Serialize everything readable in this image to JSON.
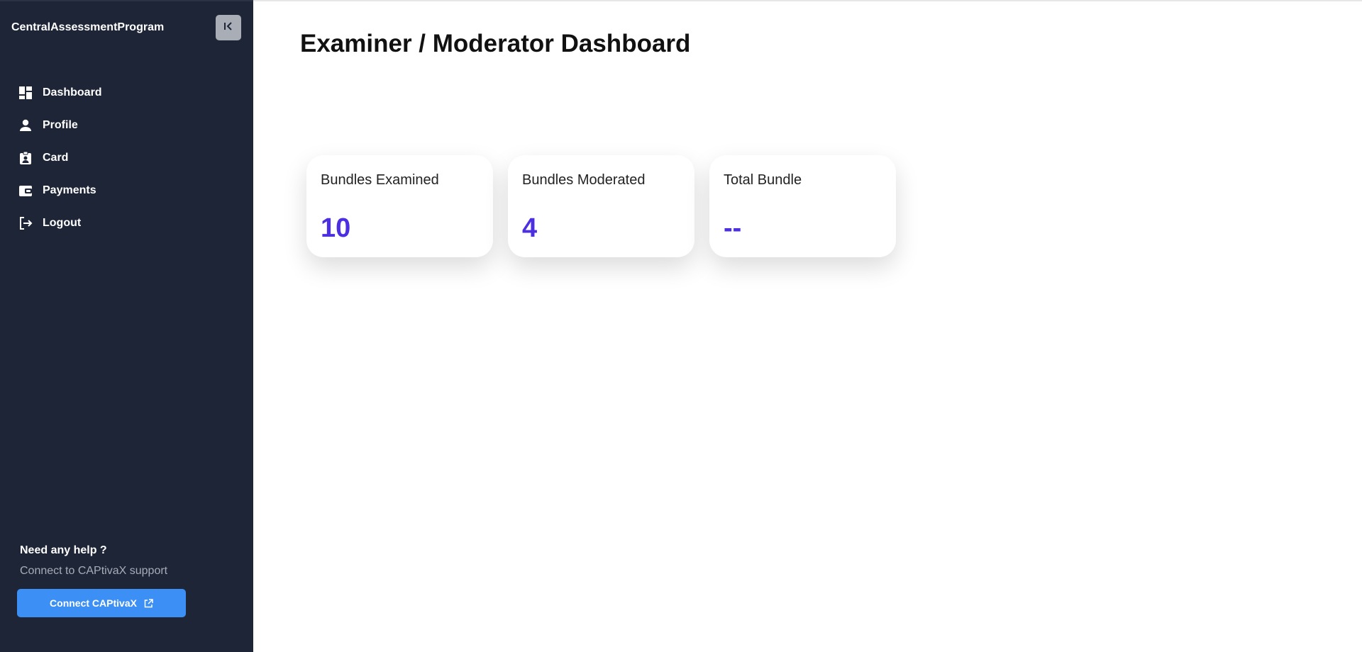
{
  "sidebar": {
    "brand": "CentralAssessmentProgram",
    "collapse_icon": "collapse-left-icon",
    "items": [
      {
        "label": "Dashboard",
        "icon": "dashboard-icon"
      },
      {
        "label": "Profile",
        "icon": "person-icon"
      },
      {
        "label": "Card",
        "icon": "id-badge-icon"
      },
      {
        "label": "Payments",
        "icon": "wallet-icon"
      },
      {
        "label": "Logout",
        "icon": "logout-icon"
      }
    ],
    "help": {
      "title": "Need any help ?",
      "subtitle": "Connect to CAPtivaX support",
      "button_label": "Connect CAPtivaX",
      "button_icon": "external-link-icon"
    }
  },
  "main": {
    "title": "Examiner / Moderator Dashboard",
    "cards": [
      {
        "label": "Bundles Examined",
        "value": "10"
      },
      {
        "label": "Bundles Moderated",
        "value": "4"
      },
      {
        "label": "Total Bundle",
        "value": "--"
      }
    ]
  },
  "colors": {
    "sidebar_bg": "#1e2537",
    "accent_value": "#4b2fe0",
    "button_blue": "#3b8ff5"
  }
}
